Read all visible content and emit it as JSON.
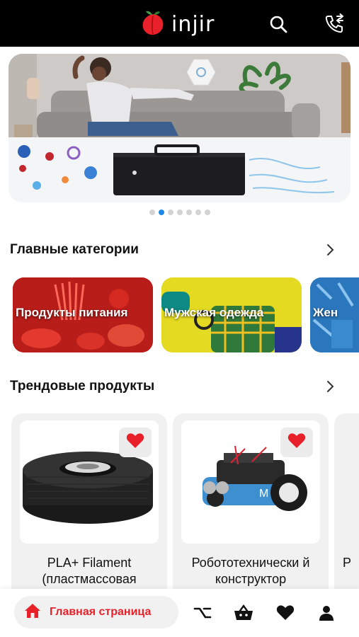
{
  "header": {
    "brand": "injir",
    "icons": [
      "fig-logo-icon",
      "search-icon",
      "phone-icon"
    ],
    "bg_color": "#000000",
    "accent_color": "#e8202a"
  },
  "banner": {
    "slide_count": 7,
    "active_slide": 2
  },
  "categories": {
    "title": "Главные категории",
    "items": [
      {
        "label": "Продукты питания",
        "color": "#d8261e"
      },
      {
        "label": "Мужская одежда",
        "color": "#e8e02a"
      },
      {
        "label": "Жен",
        "color": "#1e6fb0"
      }
    ]
  },
  "trending": {
    "title": "Трендовые продукты",
    "products": [
      {
        "title": "PLA+  Filament (пластмассовая",
        "image": "filament-spool"
      },
      {
        "title": "Робототехнически й конструктор",
        "image": "robot-kit"
      },
      {
        "title": "P",
        "image": "partial"
      }
    ]
  },
  "bottom_nav": {
    "home_label": "Главная страница",
    "icons": [
      "home-icon",
      "compare-icon",
      "basket-icon",
      "heart-icon",
      "user-icon"
    ]
  }
}
